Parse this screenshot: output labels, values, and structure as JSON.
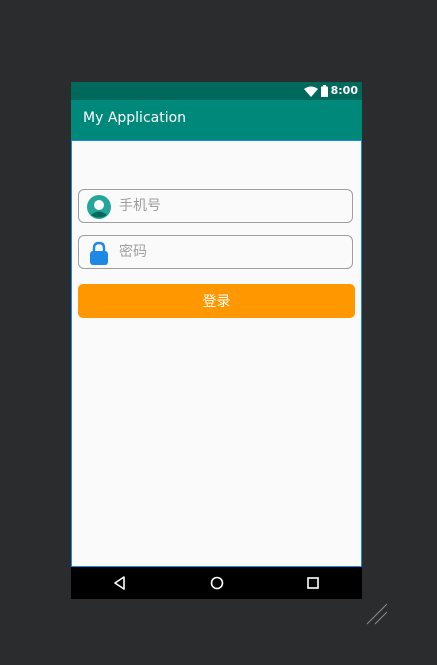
{
  "status_bar": {
    "time": "8:00",
    "wifi_icon": "wifi-icon",
    "battery_icon": "battery-icon"
  },
  "app_bar": {
    "title": "My Application"
  },
  "form": {
    "phone_placeholder": "手机号",
    "phone_icon": "user-avatar-icon",
    "password_placeholder": "密码",
    "password_icon": "lock-icon",
    "login_label": "登录"
  },
  "nav_bar": {
    "back_icon": "back-triangle-icon",
    "home_icon": "home-circle-icon",
    "recent_icon": "recent-square-icon"
  },
  "colors": {
    "status_bar": "#00695c",
    "app_bar": "#00897b",
    "login_button": "#ff9800",
    "avatar": "#26a69a",
    "lock": "#1e88e5",
    "background": "#2b2c2e"
  }
}
